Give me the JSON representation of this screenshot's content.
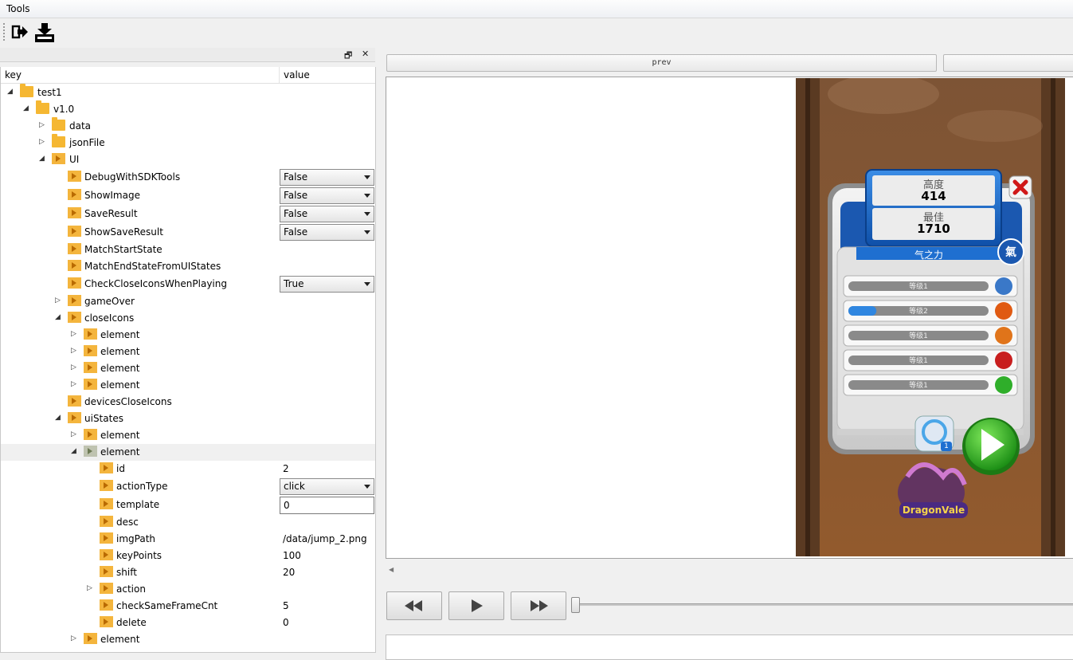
{
  "menubar": {
    "tools": "Tools"
  },
  "toolbar": {
    "exit_icon": "exit-icon",
    "save_icon": "save-download-icon"
  },
  "dock": {
    "float_glyph": "🗗",
    "close_glyph": "✕"
  },
  "tree": {
    "headers": {
      "key": "key",
      "value": "value"
    },
    "nodes": {
      "test1": "test1",
      "v1_0": "v1.0",
      "data": "data",
      "jsonFile": "jsonFile",
      "ui": "UI",
      "debug": {
        "label": "DebugWithSDKTools",
        "value": "False"
      },
      "showImage": {
        "label": "ShowImage",
        "value": "False"
      },
      "saveResult": {
        "label": "SaveResult",
        "value": "False"
      },
      "showSaveResult": {
        "label": "ShowSaveResult",
        "value": "False"
      },
      "matchStartState": "MatchStartState",
      "matchEndState": "MatchEndStateFromUIStates",
      "checkClose": {
        "label": "CheckCloseIconsWhenPlaying",
        "value": "True"
      },
      "gameOver": "gameOver",
      "closeIcons": "closeIcons",
      "element": "element",
      "devicesCloseIcons": "devicesCloseIcons",
      "uiStates": "uiStates",
      "id": {
        "label": "id",
        "value": "2"
      },
      "actionType": {
        "label": "actionType",
        "value": "click"
      },
      "template": {
        "label": "template",
        "value": "0"
      },
      "desc": "desc",
      "imgPath": {
        "label": "imgPath",
        "value": "/data/jump_2.png"
      },
      "keyPoints": {
        "label": "keyPoints",
        "value": "100"
      },
      "shift": {
        "label": "shift",
        "value": "20"
      },
      "action": "action",
      "checkSameFrameCnt": {
        "label": "checkSameFrameCnt",
        "value": "5"
      },
      "delete": {
        "label": "delete",
        "value": "0"
      }
    }
  },
  "viewer": {
    "prev_label": "prev",
    "next_label": "",
    "player": {
      "rewind": "◀◀",
      "play": "▶",
      "forward": "▶▶"
    }
  },
  "game": {
    "height_label": "高度",
    "height_value": "414",
    "best_label": "最佳",
    "best_value": "1710",
    "power_title": "气之力",
    "qi_badge": "氣",
    "upgrades": [
      {
        "label": "等级1",
        "fill": 0.0
      },
      {
        "label": "等级2",
        "fill": 0.2
      },
      {
        "label": "等级1",
        "fill": 0.0
      },
      {
        "label": "等级1",
        "fill": 0.0
      },
      {
        "label": "等级1",
        "fill": 0.0
      }
    ],
    "magnifier_count": "1",
    "logo_text": "DragonVale",
    "colors": {
      "accent_blue": "#1a6fd0",
      "play_green": "#2fb52a",
      "wood": "#8b5a32"
    }
  }
}
